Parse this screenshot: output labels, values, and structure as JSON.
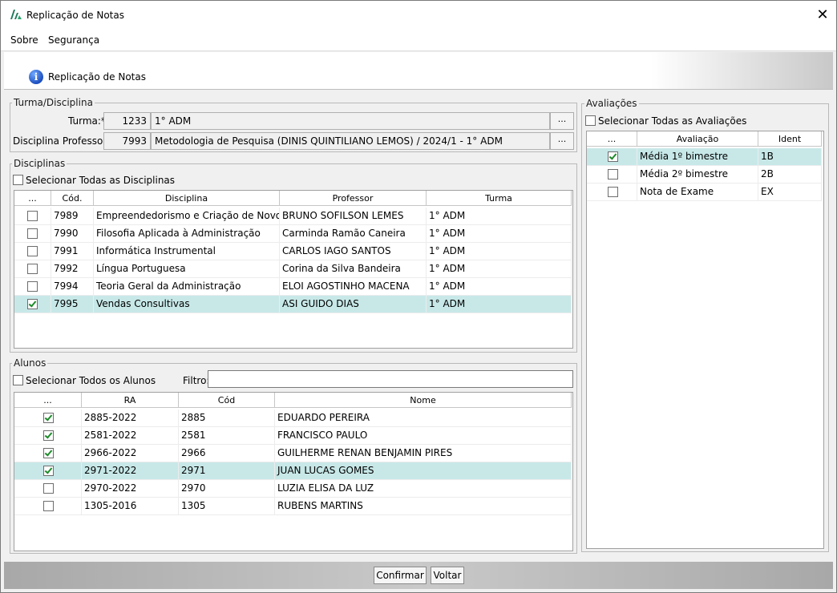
{
  "window": {
    "title": "Replicação de Notas"
  },
  "menu": {
    "items": [
      "Sobre",
      "Segurança"
    ]
  },
  "banner": {
    "text": "Replicação de Notas"
  },
  "turma_disciplina": {
    "legend": "Turma/Disciplina",
    "turma_label": "Turma:*",
    "turma_code": "1233",
    "turma_name": "1° ADM",
    "disciplina_label": "Disciplina Professor:*",
    "disciplina_code": "7993",
    "disciplina_name": "Metodologia de Pesquisa (DINIS QUINTILIANO LEMOS) / 2024/1 - 1° ADM",
    "lookup_label": "..."
  },
  "disciplinas": {
    "legend": "Disciplinas",
    "select_all_label": "Selecionar Todas as Disciplinas",
    "columns": [
      "...",
      "Cód.",
      "Disciplina",
      "Professor",
      "Turma"
    ],
    "rows": [
      {
        "checked": false,
        "selected": false,
        "cod": "7989",
        "disciplina": "Empreendedorismo e Criação de Novos ...",
        "professor": "BRUNO SOFILSON LEMES",
        "turma": "1° ADM"
      },
      {
        "checked": false,
        "selected": false,
        "cod": "7990",
        "disciplina": "Filosofia Aplicada à Administração",
        "professor": "Carminda Ramão Caneira",
        "turma": "1° ADM"
      },
      {
        "checked": false,
        "selected": false,
        "cod": "7991",
        "disciplina": "Informática Instrumental",
        "professor": "CARLOS IAGO SANTOS",
        "turma": "1° ADM"
      },
      {
        "checked": false,
        "selected": false,
        "cod": "7992",
        "disciplina": "Língua Portuguesa",
        "professor": "Corina da Silva Bandeira",
        "turma": "1° ADM"
      },
      {
        "checked": false,
        "selected": false,
        "cod": "7994",
        "disciplina": "Teoria Geral da Administração",
        "professor": "ELOI AGOSTINHO MACENA",
        "turma": "1° ADM"
      },
      {
        "checked": true,
        "selected": true,
        "cod": "7995",
        "disciplina": "Vendas Consultivas",
        "professor": "ASI GUIDO DIAS",
        "turma": "1° ADM"
      }
    ]
  },
  "alunos": {
    "legend": "Alunos",
    "select_all_label": "Selecionar Todos os Alunos",
    "filter_label": "Filtro:",
    "filter_value": "",
    "columns": [
      "...",
      "RA",
      "Cód",
      "Nome"
    ],
    "rows": [
      {
        "checked": true,
        "selected": false,
        "ra": "2885-2022",
        "cod": "2885",
        "nome": "EDUARDO PEREIRA"
      },
      {
        "checked": true,
        "selected": false,
        "ra": "2581-2022",
        "cod": "2581",
        "nome": "FRANCISCO PAULO"
      },
      {
        "checked": true,
        "selected": false,
        "ra": "2966-2022",
        "cod": "2966",
        "nome": "GUILHERME RENAN BENJAMIN PIRES"
      },
      {
        "checked": true,
        "selected": true,
        "ra": "2971-2022",
        "cod": "2971",
        "nome": "JUAN LUCAS GOMES"
      },
      {
        "checked": false,
        "selected": false,
        "ra": "2970-2022",
        "cod": "2970",
        "nome": "LUZIA ELISA DA LUZ"
      },
      {
        "checked": false,
        "selected": false,
        "ra": "1305-2016",
        "cod": "1305",
        "nome": "RUBENS MARTINS"
      }
    ]
  },
  "avaliacoes": {
    "legend": "Avaliações",
    "select_all_label": "Selecionar Todas as Avaliações",
    "columns": [
      "...",
      "Avaliação",
      "Ident"
    ],
    "rows": [
      {
        "checked": true,
        "selected": true,
        "avaliacao": "Média 1º bimestre",
        "ident": "1B"
      },
      {
        "checked": false,
        "selected": false,
        "avaliacao": "Média 2º bimestre",
        "ident": "2B"
      },
      {
        "checked": false,
        "selected": false,
        "avaliacao": "Nota de Exame",
        "ident": "EX"
      }
    ]
  },
  "buttons": {
    "confirm": "Confirmar",
    "back": "Voltar"
  },
  "icons": {
    "app": "app-logo-icon",
    "info": "info-icon",
    "close": "close-icon",
    "check": "checkmark-icon"
  },
  "colors": {
    "selected_row": "#c8e8e8",
    "check": "#1d8a2a",
    "info": "#1d4fbf"
  }
}
